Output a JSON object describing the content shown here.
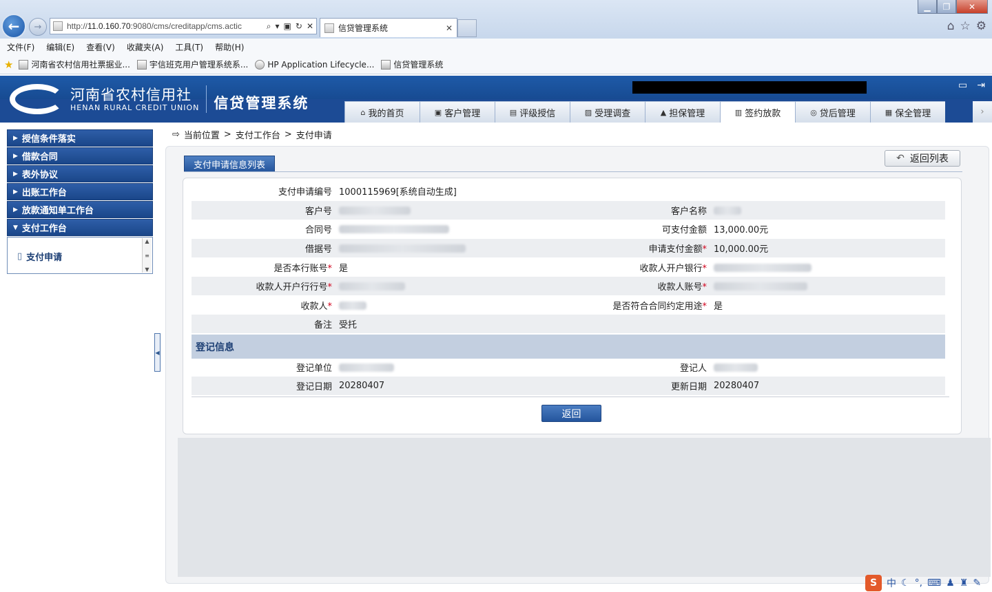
{
  "browser": {
    "url_prefix": "http://",
    "url_host": "11.0.160.70",
    "url_rest": ":9080/cms/creditapp/cms.actic",
    "tab_title": "信贷管理系统",
    "menu": [
      "文件(F)",
      "编辑(E)",
      "查看(V)",
      "收藏夹(A)",
      "工具(T)",
      "帮助(H)"
    ],
    "favorites": [
      "河南省农村信用社票据业...",
      "宇信班克用户管理系统系...",
      "HP Application Lifecycle...",
      "信贷管理系统"
    ]
  },
  "app": {
    "logo_cn": "河南省农村信用社",
    "logo_en": "HENAN RURAL CREDIT UNION",
    "system_name": "信贷管理系统",
    "nav": [
      "我的首页",
      "客户管理",
      "评级授信",
      "受理调查",
      "担保管理",
      "签约放款",
      "贷后管理",
      "保全管理"
    ],
    "nav_active": "签约放款"
  },
  "sidebar": {
    "items": [
      "授信条件落实",
      "借款合同",
      "表外协议",
      "出账工作台",
      "放款通知单工作台",
      "支付工作台"
    ],
    "expanded": "支付工作台",
    "sub_items": [
      "支付申请"
    ]
  },
  "breadcrumb": {
    "label": "当前位置",
    "sep": ">",
    "path": [
      "支付工作台",
      "支付申请"
    ]
  },
  "content": {
    "section_tab": "支付申请信息列表",
    "back_to_list": "返回列表",
    "fields": {
      "apply_no_label": "支付申请编号",
      "apply_no_value": "1000115969[系统自动生成]",
      "customer_no_label": "客户号",
      "customer_name_label": "客户名称",
      "contract_no_label": "合同号",
      "payable_amount_label": "可支付金额",
      "payable_amount_value": "13,000.00元",
      "loan_no_label": "借据号",
      "apply_amount_label": "申请支付金额",
      "apply_amount_value": "10,000.00元",
      "own_bank_label": "是否本行账号",
      "own_bank_value": "是",
      "payee_bank_label": "收款人开户银行",
      "payee_bank_no_label": "收款人开户行行号",
      "payee_account_label": "收款人账号",
      "payee_label": "收款人",
      "purpose_match_label": "是否符合合同约定用途",
      "purpose_match_value": "是",
      "remark_label": "备注",
      "remark_value": "受托"
    },
    "register": {
      "header": "登记信息",
      "unit_label": "登记单位",
      "person_label": "登记人",
      "date_label": "登记日期",
      "date_value": "20280407",
      "update_label": "更新日期",
      "update_value": "20280407"
    },
    "return_button": "返回"
  },
  "ime": {
    "logo": "S",
    "mode": "中"
  }
}
